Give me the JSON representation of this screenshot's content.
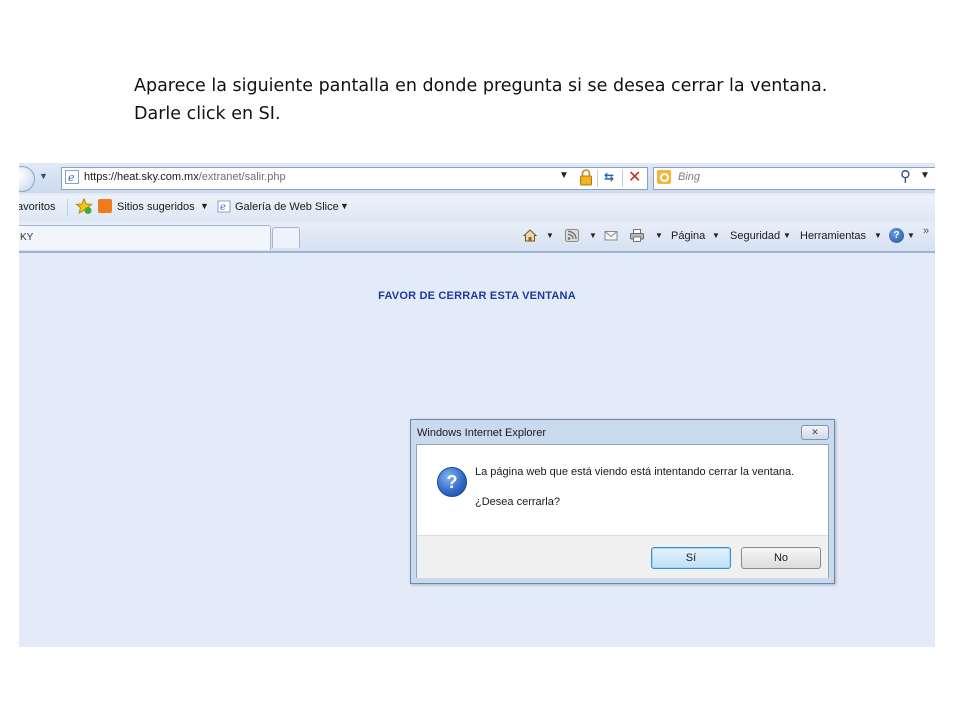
{
  "instructions": {
    "line1": "Aparece la siguiente pantalla en donde pregunta si se desea cerrar la ventana.",
    "line2": "Darle click en SI."
  },
  "browser": {
    "url_host": "https://heat.sky.com.mx",
    "url_path": "/extranet/salir.php",
    "search_placeholder": "Bing",
    "favorites": {
      "label": "avoritos",
      "suggested_sites": "Sitios sugeridos",
      "web_slice_gallery": "Galería de Web Slice"
    },
    "tab_label": "KY",
    "commands": {
      "page": "Página",
      "security": "Seguridad",
      "tools": "Herramientas",
      "more": "»"
    }
  },
  "page": {
    "message": "FAVOR DE CERRAR ESTA VENTANA"
  },
  "dialog": {
    "title": "Windows Internet Explorer",
    "message": "La página web que está viendo está intentando cerrar la ventana.",
    "question": "¿Desea cerrarla?",
    "yes_label": "Sí",
    "no_label": "No"
  },
  "colors": {
    "page_background": "#e4ebf8",
    "page_message": "#1a3a9e",
    "yes_button_border": "#3b8fd0"
  }
}
